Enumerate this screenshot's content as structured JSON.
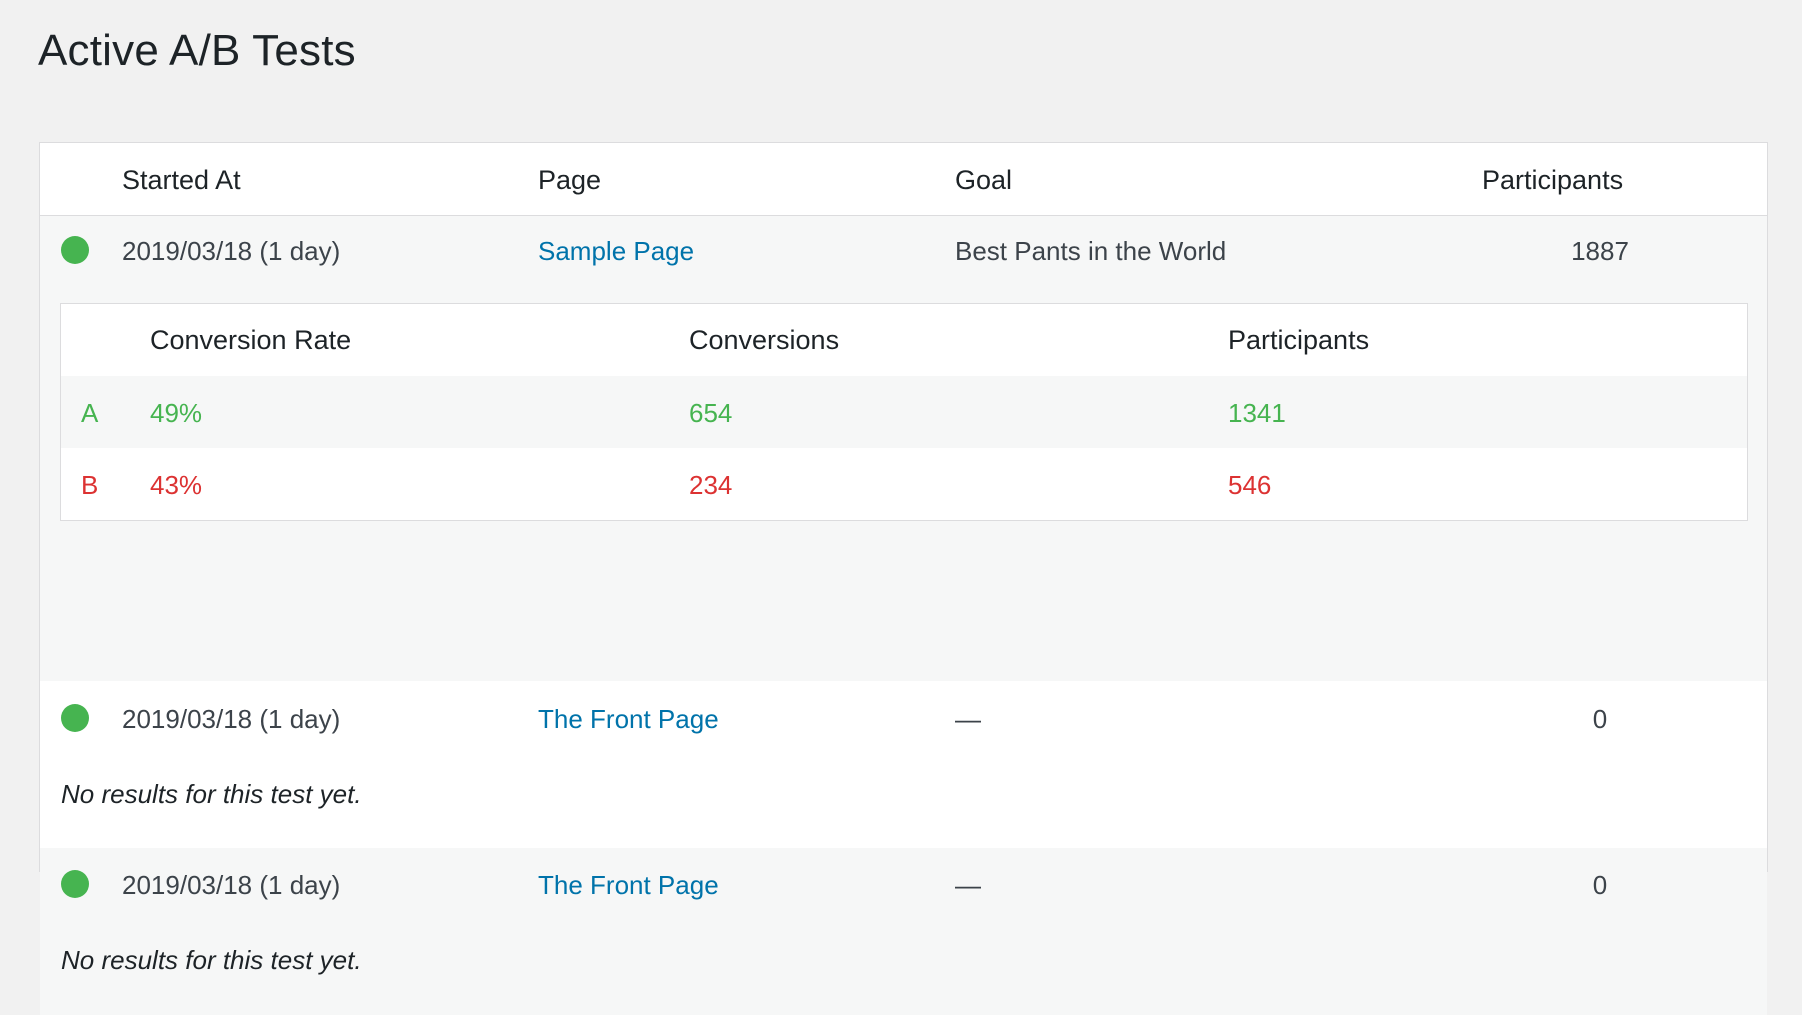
{
  "page": {
    "title": "Active A/B Tests"
  },
  "colors": {
    "winner": "#46b450",
    "loser": "#dc3232",
    "link": "#0073aa",
    "status_active": "#46b450"
  },
  "table": {
    "headers": {
      "started_at": "Started At",
      "page": "Page",
      "goal": "Goal",
      "participants": "Participants"
    },
    "tests": [
      {
        "status_icon": "active-status-dot",
        "started_at": "2019/03/18 (1 day)",
        "page": "Sample Page",
        "goal": "Best Pants in the World",
        "participants": "1887",
        "results": {
          "headers": {
            "conversion_rate": "Conversion Rate",
            "conversions": "Conversions",
            "participants": "Participants"
          },
          "variants": [
            {
              "label": "A",
              "conversion_rate": "49%",
              "conversions": "654",
              "participants": "1341"
            },
            {
              "label": "B",
              "conversion_rate": "43%",
              "conversions": "234",
              "participants": "546"
            }
          ]
        }
      },
      {
        "status_icon": "active-status-dot",
        "started_at": "2019/03/18 (1 day)",
        "page": "The Front Page",
        "goal": "—",
        "participants": "0",
        "no_results_text": "No results for this test yet."
      },
      {
        "status_icon": "active-status-dot",
        "started_at": "2019/03/18 (1 day)",
        "page": "The Front Page",
        "goal": "—",
        "participants": "0",
        "no_results_text": "No results for this test yet."
      }
    ]
  }
}
